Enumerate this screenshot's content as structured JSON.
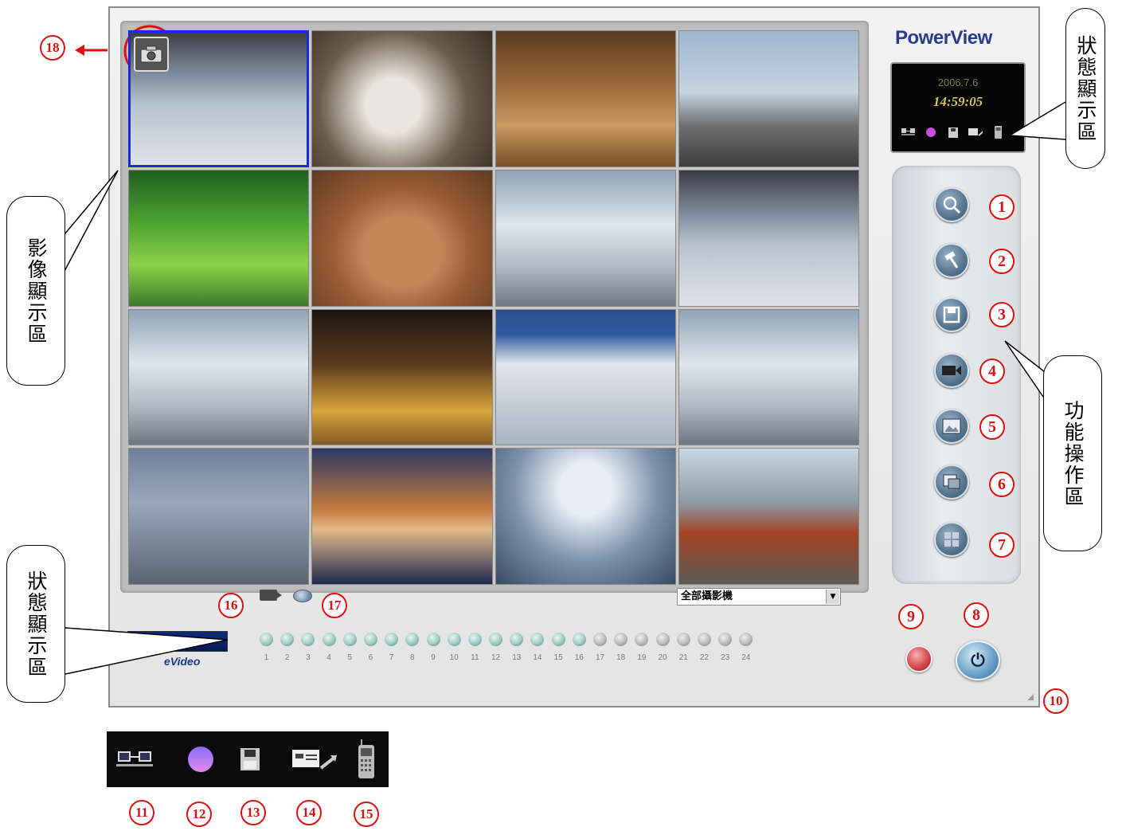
{
  "brand": "PowerView",
  "status": {
    "date": "2006.7.6",
    "time": "14:59:05",
    "icons": [
      "network-icon",
      "recording-indicator-icon",
      "save-icon",
      "alert-transfer-icon",
      "mobile-phone-icon"
    ]
  },
  "cameras": [
    {
      "scene": "train-station-platform"
    },
    {
      "scene": "meeting-room"
    },
    {
      "scene": "stadium-crowd"
    },
    {
      "scene": "container-port"
    },
    {
      "scene": "green-train"
    },
    {
      "scene": "round-table-meeting"
    },
    {
      "scene": "metro-platform"
    },
    {
      "scene": "station-hall"
    },
    {
      "scene": "platform-passengers"
    },
    {
      "scene": "tiled-corridor"
    },
    {
      "scene": "station-sign"
    },
    {
      "scene": "platform-passengers-2"
    },
    {
      "scene": "skyscrapers"
    },
    {
      "scene": "bridge-night"
    },
    {
      "scene": "glass-dome"
    },
    {
      "scene": "high-speed-train"
    }
  ],
  "camera_selector": {
    "value": "全部攝影機"
  },
  "function_buttons": [
    {
      "number": "1",
      "icon": "search-icon"
    },
    {
      "number": "2",
      "icon": "hammer-settings-icon"
    },
    {
      "number": "3",
      "icon": "floppy-save-icon"
    },
    {
      "number": "4",
      "icon": "video-camera-icon"
    },
    {
      "number": "5",
      "icon": "picture-icon"
    },
    {
      "number": "6",
      "icon": "playback-icon"
    },
    {
      "number": "7",
      "icon": "grid-layout-icon"
    }
  ],
  "channels": [
    {
      "n": "1",
      "on": true
    },
    {
      "n": "2",
      "on": true
    },
    {
      "n": "3",
      "on": true
    },
    {
      "n": "4",
      "on": true
    },
    {
      "n": "5",
      "on": true
    },
    {
      "n": "6",
      "on": true
    },
    {
      "n": "7",
      "on": true
    },
    {
      "n": "8",
      "on": true
    },
    {
      "n": "9",
      "on": true
    },
    {
      "n": "10",
      "on": true
    },
    {
      "n": "11",
      "on": true
    },
    {
      "n": "12",
      "on": true
    },
    {
      "n": "13",
      "on": true
    },
    {
      "n": "14",
      "on": true
    },
    {
      "n": "15",
      "on": true
    },
    {
      "n": "16",
      "on": true
    },
    {
      "n": "17",
      "on": false
    },
    {
      "n": "18",
      "on": false
    },
    {
      "n": "19",
      "on": false
    },
    {
      "n": "20",
      "on": false
    },
    {
      "n": "21",
      "on": false
    },
    {
      "n": "22",
      "on": false
    },
    {
      "n": "23",
      "on": false
    },
    {
      "n": "24",
      "on": false
    }
  ],
  "logo_text": "eVideo",
  "callouts": {
    "status_top": "狀態顯示區",
    "video": "影像顯示區",
    "function": "功能操作區",
    "status_bottom": "狀態顯示區"
  },
  "markers": {
    "m1": "1",
    "m2": "2",
    "m3": "3",
    "m4": "4",
    "m5": "5",
    "m6": "6",
    "m7": "7",
    "m8": "8",
    "m9": "9",
    "m10": "10",
    "m11": "11",
    "m12": "12",
    "m13": "13",
    "m14": "14",
    "m15": "15",
    "m16": "16",
    "m17": "17",
    "m18": "18"
  },
  "colors": {
    "marker_red": "#dd1111",
    "selection_blue": "#1a2bd6",
    "brand_blue": "#2a3a8c"
  }
}
